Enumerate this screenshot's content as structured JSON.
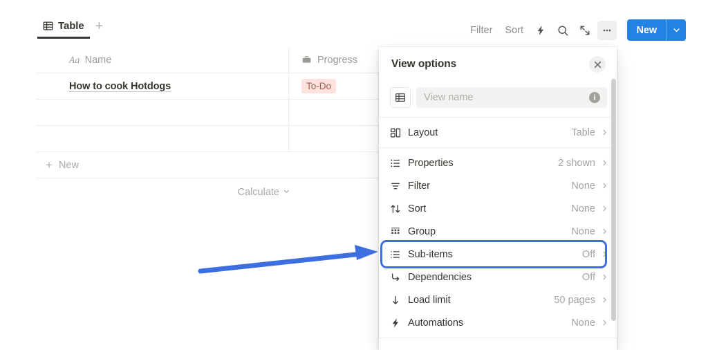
{
  "tabs": {
    "items": [
      {
        "label": "Table",
        "icon": "table-icon",
        "active": true
      }
    ],
    "add_label": "+"
  },
  "toolbar": {
    "filter_label": "Filter",
    "sort_label": "Sort",
    "automation_icon": "lightning-icon",
    "search_icon": "search-icon",
    "expand_icon": "expand-icon",
    "more_icon": "ellipsis-icon",
    "new_label": "New",
    "new_caret_icon": "chevron-down-icon"
  },
  "table": {
    "columns": [
      {
        "label": "Name",
        "prefix": "Aa",
        "icon": "text-type-icon"
      },
      {
        "label": "Progress",
        "icon": "briefcase-icon"
      }
    ],
    "rows": [
      {
        "name": "How to cook Hotdogs",
        "progress": "To-Do",
        "progress_color": "#ffe2dd",
        "progress_text_color": "#9f5b52"
      },
      {
        "name": "",
        "progress": ""
      },
      {
        "name": "",
        "progress": ""
      }
    ],
    "new_row_label": "New",
    "new_row_icon": "plus-icon",
    "calculate_label": "Calculate",
    "calculate_caret_icon": "chevron-down-icon"
  },
  "panel": {
    "title": "View options",
    "close_icon": "close-icon",
    "view_name": {
      "icon": "table-icon",
      "value": "",
      "placeholder": "View name",
      "info_icon": "info-icon"
    },
    "groups": [
      {
        "items": [
          {
            "label": "Layout",
            "value": "Table",
            "icon": "layout-icon",
            "chevron": "chevron-right-icon"
          }
        ]
      },
      {
        "items": [
          {
            "label": "Properties",
            "value": "2 shown",
            "icon": "properties-icon",
            "chevron": "chevron-right-icon"
          },
          {
            "label": "Filter",
            "value": "None",
            "icon": "filter-icon",
            "chevron": "chevron-right-icon"
          },
          {
            "label": "Sort",
            "value": "None",
            "icon": "sort-icon",
            "chevron": "chevron-right-icon"
          },
          {
            "label": "Group",
            "value": "None",
            "icon": "group-icon",
            "chevron": "chevron-right-icon"
          },
          {
            "label": "Sub-items",
            "value": "Off",
            "icon": "subitems-icon",
            "chevron": "chevron-right-icon",
            "highlighted": true
          },
          {
            "label": "Dependencies",
            "value": "Off",
            "icon": "dependencies-icon",
            "chevron": "chevron-right-icon"
          },
          {
            "label": "Load limit",
            "value": "50 pages",
            "icon": "arrow-down-icon",
            "chevron": "chevron-right-icon"
          },
          {
            "label": "Automations",
            "value": "None",
            "icon": "lightning-icon",
            "chevron": "chevron-right-icon"
          }
        ]
      }
    ]
  },
  "annotation": {
    "arrow_color": "#3d6fe0",
    "highlight_color": "#3d6fe0",
    "target": "Sub-items"
  },
  "colors": {
    "accent_blue": "#2383e2",
    "annotation_blue": "#3d6fe0",
    "text_primary": "#37352f",
    "text_muted": "#9b9a97",
    "tag_todo_bg": "#ffe2dd"
  }
}
